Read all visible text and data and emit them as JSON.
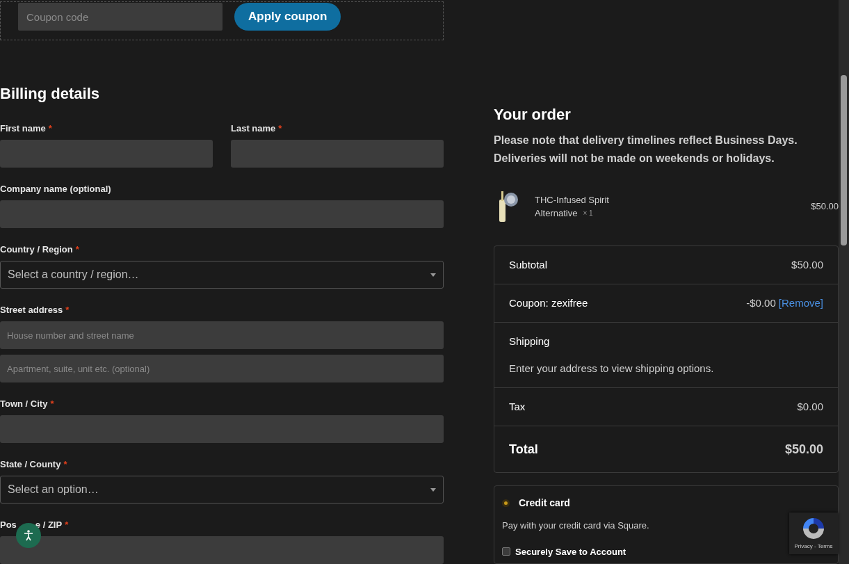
{
  "coupon": {
    "placeholder": "Coupon code",
    "button": "Apply coupon"
  },
  "billing": {
    "title": "Billing details",
    "rows": [
      [
        {
          "kind": "text",
          "label": "First name",
          "required_mark": "*"
        },
        {
          "kind": "text",
          "label": "Last name",
          "required_mark": "*"
        }
      ],
      [
        {
          "kind": "text",
          "label": "Company name (optional)"
        }
      ],
      [
        {
          "kind": "select",
          "label": "Country / Region",
          "required_mark": "*",
          "value": "Select a country / region…"
        }
      ],
      [
        {
          "kind": "multi",
          "label": "Street address",
          "required_mark": "*",
          "placeholders": [
            "House number and street name",
            "Apartment, suite, unit etc. (optional)"
          ]
        }
      ],
      [
        {
          "kind": "text",
          "label": "Town / City",
          "required_mark": "*"
        }
      ],
      [
        {
          "kind": "select",
          "label": "State / County",
          "required_mark": "*",
          "value": "Select an option…"
        }
      ],
      [
        {
          "kind": "text",
          "label_parts": [
            "Pos",
            "e / ZIP"
          ],
          "required_mark": "*"
        }
      ]
    ]
  },
  "order": {
    "title": "Your order",
    "note": "Please note that delivery timelines reflect Business Days. Deliveries will not be made on weekends or holidays.",
    "product": {
      "name": "THC-Infused Spirit",
      "variant": "Alternative",
      "quantity": "× 1",
      "price": "$50.00"
    },
    "totals": [
      {
        "kind": "line",
        "label": "Subtotal",
        "value": "$50.00"
      },
      {
        "kind": "coupon",
        "label": "Coupon: zexifree",
        "value": "-$0.00",
        "link": "[Remove]"
      },
      {
        "kind": "shipping",
        "label": "Shipping",
        "text": "Enter your address to view shipping options."
      },
      {
        "kind": "line",
        "label": "Tax",
        "value": "$0.00"
      },
      {
        "kind": "total",
        "label": "Total",
        "value": "$50.00"
      }
    ]
  },
  "payment": {
    "method": "Credit card",
    "selected": true,
    "description": "Pay with your credit card via Square.",
    "save": {
      "label": "Securely Save to Account",
      "checked": false
    }
  },
  "recaptcha": {
    "links": "Privacy - Terms"
  }
}
